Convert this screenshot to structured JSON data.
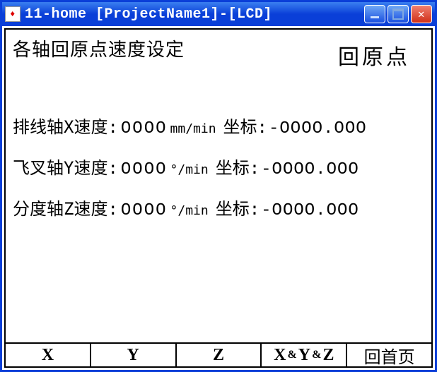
{
  "window": {
    "title": "11-home [ProjectName1]-[LCD]"
  },
  "heading": {
    "left": "各轴回原点速度设定",
    "right": "回原点"
  },
  "axes": [
    {
      "label": "排线轴X速度:",
      "speed": "OOOO",
      "unit": "mm/min",
      "coord_label": "坐标:",
      "coord": "-OOOO.OOO"
    },
    {
      "label": "飞叉轴Y速度:",
      "speed": "OOOO",
      "unit": "°/min",
      "coord_label": "坐标:",
      "coord": "-OOOO.OOO"
    },
    {
      "label": "分度轴Z速度:",
      "speed": "OOOO",
      "unit": "°/min",
      "coord_label": "坐标:",
      "coord": "-OOOO.OOO"
    }
  ],
  "buttons": {
    "b1": "X",
    "b2": "Y",
    "b3": "Z",
    "b4a": "X",
    "b4b": "Y",
    "b4c": "Z",
    "amp": "&",
    "b5": "回首页"
  }
}
